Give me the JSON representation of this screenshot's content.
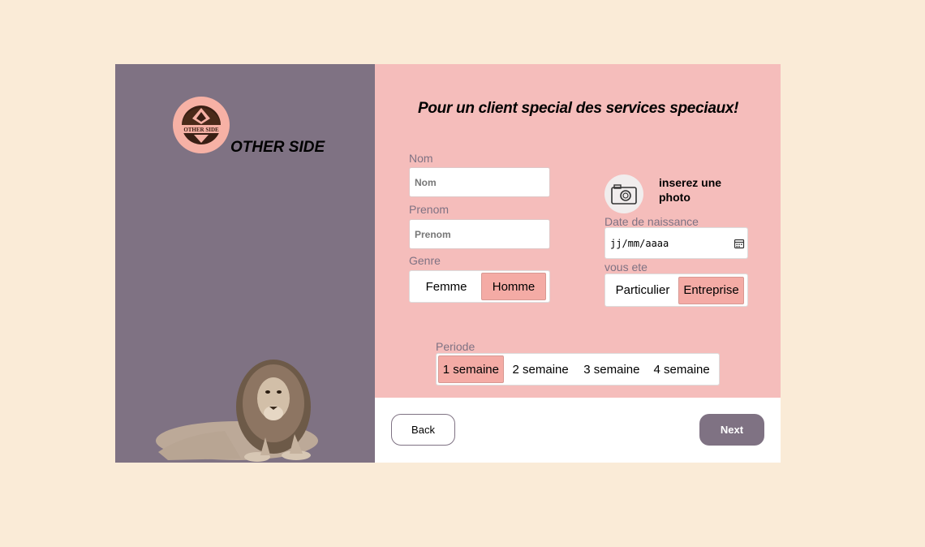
{
  "brand": {
    "name": "OTHER SIDE",
    "logo_text": "OTHER SIDE"
  },
  "form": {
    "headline": "Pour un client special des services speciaux!",
    "nom": {
      "label": "Nom",
      "placeholder": "Nom"
    },
    "prenom": {
      "label": "Prenom",
      "placeholder": "Prenom"
    },
    "genre": {
      "label": "Genre",
      "options": [
        "Femme",
        "Homme"
      ],
      "selected": "Homme"
    },
    "photo": {
      "label": "inserez une photo"
    },
    "date": {
      "label": "Date de naissance",
      "placeholder": "jj/mm/aaaa"
    },
    "type": {
      "label": "vous ete",
      "options": [
        "Particulier",
        "Entreprise"
      ],
      "selected": "Entreprise"
    },
    "periode": {
      "label": "Periode",
      "options": [
        "1 semaine",
        "2 semaine",
        "3 semaine",
        "4 semaine"
      ],
      "selected": "1 semaine"
    }
  },
  "nav": {
    "back": "Back",
    "next": "Next"
  },
  "colors": {
    "page_bg": "#faebd7",
    "sidebar": "#7f7283",
    "panel": "#f5bdbb",
    "accent": "#f4aba5",
    "button_next": "#7f7283"
  },
  "icons": {
    "photo": "camera-icon",
    "date": "calendar-icon"
  }
}
